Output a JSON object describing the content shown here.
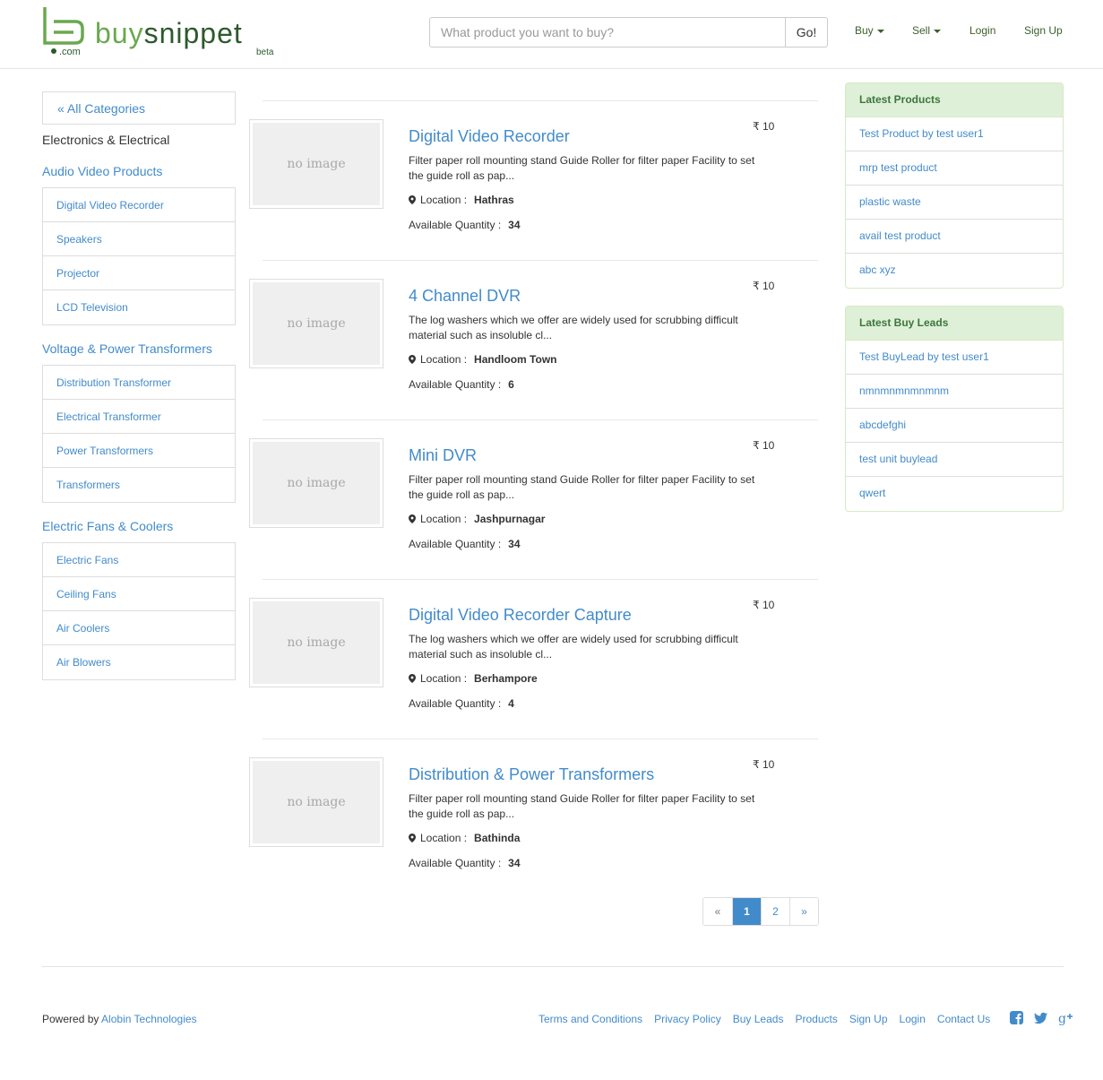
{
  "header": {
    "logo_text": "buysnippet",
    "logo_suffix": ".com",
    "logo_badge": "beta",
    "search_placeholder": "What product you want to buy?",
    "search_button": "Go!",
    "nav": {
      "buy": "Buy",
      "sell": "Sell",
      "login": "Login",
      "signup": "Sign Up"
    }
  },
  "sidebar": {
    "all_categories": "« All Categories",
    "main_category": "Electronics & Electrical",
    "groups": [
      {
        "title": "Audio Video Products",
        "items": [
          "Digital Video Recorder",
          "Speakers",
          "Projector",
          "LCD Television"
        ]
      },
      {
        "title": "Voltage & Power Transformers",
        "items": [
          "Distribution Transformer",
          "Electrical Transformer",
          "Power Transformers",
          "Transformers"
        ]
      },
      {
        "title": "Electric Fans & Coolers",
        "items": [
          "Electric Fans",
          "Ceiling Fans",
          "Air Coolers",
          "Air Blowers"
        ]
      }
    ]
  },
  "products": {
    "no_image_text": "no image",
    "location_label": "Location :",
    "quantity_label": "Available Quantity :",
    "items": [
      {
        "title": "Digital Video Recorder",
        "price": "₹ 10",
        "desc_line1": "Filter paper roll mounting stand Guide Roller for filter paper Facility to set",
        "desc_line2": "the guide roll as pap...",
        "location": "Hathras",
        "quantity": "34"
      },
      {
        "title": "4 Channel DVR",
        "price": "₹ 10",
        "desc_line1": "The log washers which we offer are widely used for scrubbing difficult",
        "desc_line2": "material such as insoluble cl...",
        "location": "Handloom Town",
        "quantity": "6"
      },
      {
        "title": "Mini DVR",
        "price": "₹ 10",
        "desc_line1": "Filter paper roll mounting stand Guide Roller for filter paper Facility to set",
        "desc_line2": "the guide roll as pap...",
        "location": "Jashpurnagar",
        "quantity": "34"
      },
      {
        "title": "Digital Video Recorder Capture",
        "price": "₹ 10",
        "desc_line1": "The log washers which we offer are widely used for scrubbing difficult",
        "desc_line2": "material such as insoluble cl...",
        "location": "Berhampore",
        "quantity": "4"
      },
      {
        "title": "Distribution & Power Transformers",
        "price": "₹ 10",
        "desc_line1": "Filter paper roll mounting stand Guide Roller for filter paper Facility to set",
        "desc_line2": "the guide roll as pap...",
        "location": "Bathinda",
        "quantity": "34"
      }
    ]
  },
  "pagination": {
    "prev": "«",
    "pages": [
      "1",
      "2"
    ],
    "active": "1",
    "next": "»"
  },
  "latest_products": {
    "title": "Latest Products",
    "items": [
      "Test Product by test user1",
      "mrp test product",
      "plastic waste",
      "avail test product",
      "abc xyz"
    ]
  },
  "latest_buy_leads": {
    "title": "Latest Buy Leads",
    "items": [
      "Test BuyLead by test user1",
      "nmnmnmnmnmnm",
      "abcdefghi",
      "test unit buylead",
      "qwert"
    ]
  },
  "footer": {
    "powered_by": "Powered by",
    "company": "Alobin Technologies",
    "links": [
      "Terms and Conditions",
      "Privacy Policy",
      "Buy Leads",
      "Products",
      "Sign Up",
      "Login",
      "Contact Us"
    ]
  },
  "colors": {
    "brand_green": "#6aa84f",
    "link_blue": "#428bca",
    "panel_header_bg": "#dff0d8",
    "panel_header_text": "#3c763d"
  }
}
